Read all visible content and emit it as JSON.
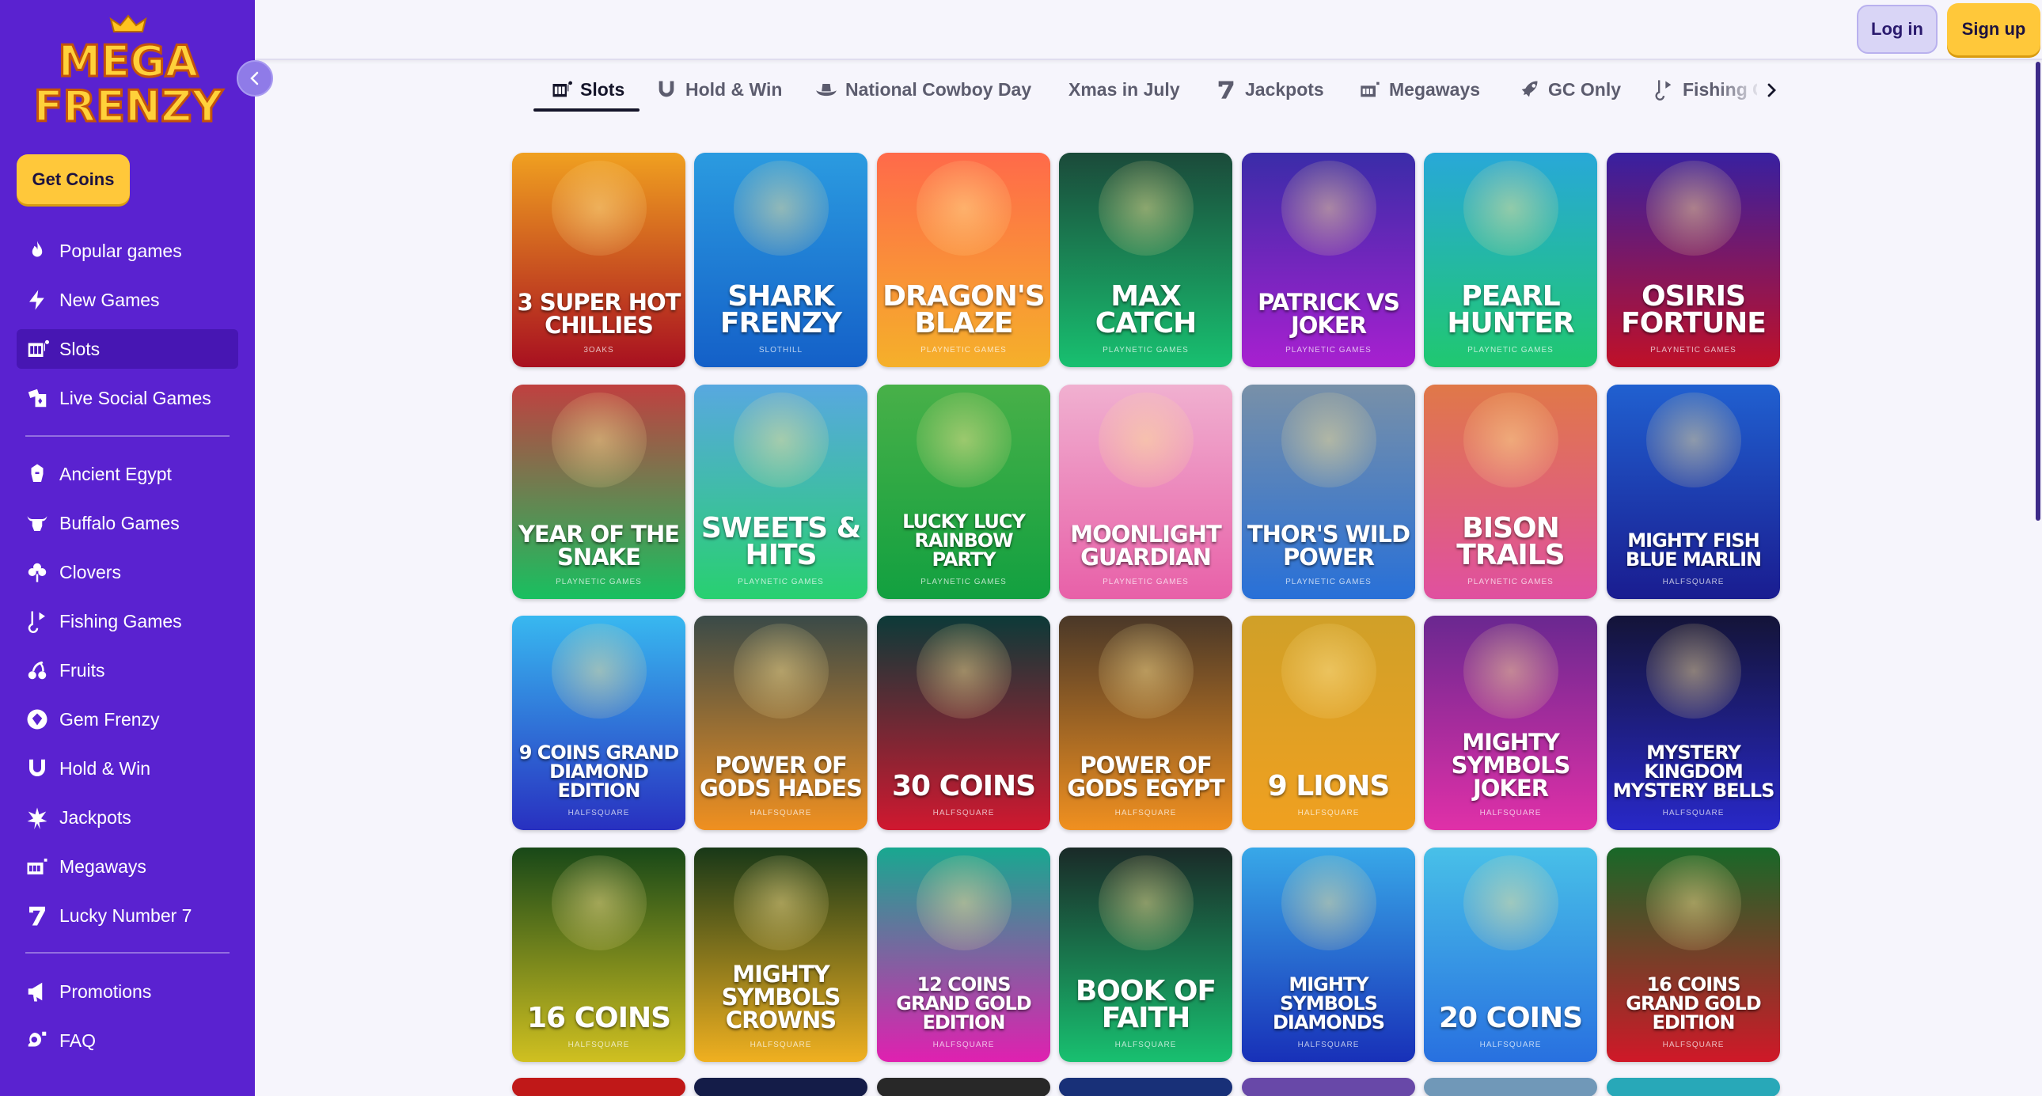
{
  "brand": {
    "logo_line1": "MEGA",
    "logo_line2": "FRENZY"
  },
  "sidebar": {
    "get_coins": "Get Coins",
    "main_items": [
      {
        "label": "Popular games",
        "icon": "flame-icon"
      },
      {
        "label": "New Games",
        "icon": "lightning-icon"
      },
      {
        "label": "Slots",
        "icon": "slot-machine-icon",
        "active": true
      },
      {
        "label": "Live Social Games",
        "icon": "cards-icon"
      }
    ],
    "category_items": [
      {
        "label": "Ancient Egypt",
        "icon": "pharaoh-icon"
      },
      {
        "label": "Buffalo Games",
        "icon": "buffalo-icon"
      },
      {
        "label": "Clovers",
        "icon": "clover-icon"
      },
      {
        "label": "Fishing Games",
        "icon": "fishing-icon"
      },
      {
        "label": "Fruits",
        "icon": "cherry-icon"
      },
      {
        "label": "Gem Frenzy",
        "icon": "gem-icon"
      },
      {
        "label": "Hold & Win",
        "icon": "horseshoe-icon"
      },
      {
        "label": "Jackpots",
        "icon": "jackpot-icon"
      },
      {
        "label": "Megaways",
        "icon": "megaways-icon"
      },
      {
        "label": "Lucky Number 7",
        "icon": "seven-icon"
      }
    ],
    "bottom_items": [
      {
        "label": "Promotions",
        "icon": "megaphone-icon"
      },
      {
        "label": "FAQ",
        "icon": "faq-icon"
      }
    ]
  },
  "header": {
    "login": "Log in",
    "signup": "Sign up"
  },
  "tabs": [
    {
      "label": "Slots",
      "icon": "slot-machine-icon",
      "active": true
    },
    {
      "label": "Hold & Win",
      "icon": "horseshoe-icon"
    },
    {
      "label": "National Cowboy Day",
      "icon": "cowboy-hat-icon"
    },
    {
      "label": "Xmas in July",
      "icon": ""
    },
    {
      "label": "Jackpots",
      "icon": "seven-icon"
    },
    {
      "label": "Megaways",
      "icon": "megaways-icon"
    },
    {
      "label": "GC Only",
      "icon": "rocket-icon"
    },
    {
      "label": "Fishing Games",
      "icon": "fishing-icon"
    }
  ],
  "games": [
    [
      {
        "title": "3 SUPER HOT CHILLIES",
        "provider": "3OAKS",
        "colors": [
          "#f0a020",
          "#a81020"
        ]
      },
      {
        "title": "SHARK FRENZY",
        "provider": "SLOTHILL",
        "colors": [
          "#2b9be0",
          "#1460c8"
        ]
      },
      {
        "title": "DRAGON'S BLAZE",
        "provider": "PLAYNETIC GAMES",
        "colors": [
          "#ff6a4a",
          "#f5b02a"
        ]
      },
      {
        "title": "MAX CATCH",
        "provider": "PLAYNETIC GAMES",
        "colors": [
          "#1b4a3a",
          "#18c070"
        ]
      },
      {
        "title": "PATRICK VS JOKER",
        "provider": "PLAYNETIC GAMES",
        "colors": [
          "#3a2ca8",
          "#a820d0"
        ]
      },
      {
        "title": "PEARL HUNTER",
        "provider": "PLAYNETIC GAMES",
        "colors": [
          "#28a8d8",
          "#20c870"
        ]
      },
      {
        "title": "OSIRIS FORTUNE",
        "provider": "PLAYNETIC GAMES",
        "colors": [
          "#3820a0",
          "#c01028"
        ]
      }
    ],
    [
      {
        "title": "YEAR OF THE SNAKE",
        "provider": "PLAYNETIC GAMES",
        "colors": [
          "#c04040",
          "#18c060"
        ]
      },
      {
        "title": "SWEETS & HITS",
        "provider": "PLAYNETIC GAMES",
        "colors": [
          "#58a8e0",
          "#28d070"
        ]
      },
      {
        "title": "LUCKY LUCY RAINBOW PARTY",
        "provider": "PLAYNETIC GAMES",
        "colors": [
          "#48b048",
          "#12a040"
        ]
      },
      {
        "title": "MOONLIGHT GUARDIAN",
        "provider": "PLAYNETIC GAMES",
        "colors": [
          "#f0b0d0",
          "#e860a8"
        ]
      },
      {
        "title": "THOR'S WILD POWER",
        "provider": "PLAYNETIC GAMES",
        "colors": [
          "#7890a8",
          "#2870d8"
        ]
      },
      {
        "title": "BISON TRAILS",
        "provider": "PLAYNETIC GAMES",
        "colors": [
          "#e07848",
          "#e050a0"
        ]
      },
      {
        "title": "MIGHTY FISH BLUE MARLIN",
        "provider": "HALFSQUARE",
        "colors": [
          "#2060d0",
          "#1a1c90"
        ]
      }
    ],
    [
      {
        "title": "9 COINS GRAND DIAMOND EDITION",
        "provider": "HALFSQUARE",
        "colors": [
          "#38b8f0",
          "#2830c0"
        ]
      },
      {
        "title": "POWER OF GODS HADES",
        "provider": "HALFSQUARE",
        "colors": [
          "#3a4a48",
          "#f09020"
        ]
      },
      {
        "title": "30 COINS",
        "provider": "HALFSQUARE",
        "colors": [
          "#0c3a38",
          "#d01830"
        ]
      },
      {
        "title": "POWER OF GODS EGYPT",
        "provider": "HALFSQUARE",
        "colors": [
          "#4a3828",
          "#f09020"
        ]
      },
      {
        "title": "9 LIONS",
        "provider": "HALFSQUARE",
        "colors": [
          "#d0a028",
          "#f0a020"
        ]
      },
      {
        "title": "MIGHTY SYMBOLS JOKER",
        "provider": "HALFSQUARE",
        "colors": [
          "#6a2890",
          "#e030a8"
        ]
      },
      {
        "title": "MYSTERY KINGDOM MYSTERY BELLS",
        "provider": "HALFSQUARE",
        "colors": [
          "#141438",
          "#2828c8"
        ]
      }
    ],
    [
      {
        "title": "16 COINS",
        "provider": "HALFSQUARE",
        "colors": [
          "#184818",
          "#d0c020"
        ]
      },
      {
        "title": "MIGHTY SYMBOLS CROWNS",
        "provider": "HALFSQUARE",
        "colors": [
          "#183818",
          "#f0b020"
        ]
      },
      {
        "title": "12 COINS GRAND GOLD EDITION",
        "provider": "HALFSQUARE",
        "colors": [
          "#18a890",
          "#e020b0"
        ]
      },
      {
        "title": "BOOK OF FAITH",
        "provider": "HALFSQUARE",
        "colors": [
          "#1a2a28",
          "#18c070"
        ]
      },
      {
        "title": "MIGHTY SYMBOLS DIAMONDS",
        "provider": "HALFSQUARE",
        "colors": [
          "#38a8e8",
          "#1830b8"
        ]
      },
      {
        "title": "20 COINS",
        "provider": "HALFSQUARE",
        "colors": [
          "#48c0e8",
          "#2870e0"
        ]
      },
      {
        "title": "16 COINS GRAND GOLD EDITION",
        "provider": "HALFSQUARE",
        "colors": [
          "#186828",
          "#d01828"
        ]
      }
    ],
    [
      {
        "colors": [
          "#c01818",
          "#c01818"
        ]
      },
      {
        "colors": [
          "#141c48",
          "#141c48"
        ]
      },
      {
        "colors": [
          "#282828",
          "#282828"
        ]
      },
      {
        "colors": [
          "#183078",
          "#183078"
        ]
      },
      {
        "colors": [
          "#6848a8",
          "#6848a8"
        ]
      },
      {
        "colors": [
          "#7098b8",
          "#7098b8"
        ]
      },
      {
        "colors": [
          "#28a8b8",
          "#28a8b8"
        ]
      }
    ]
  ]
}
